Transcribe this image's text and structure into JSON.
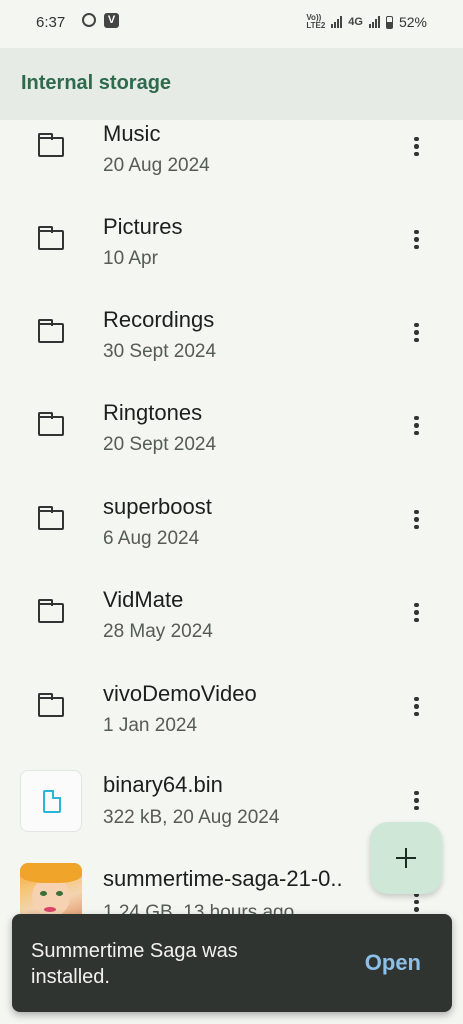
{
  "status_bar": {
    "time": "6:37",
    "notification_icon_2": "V",
    "volte_line1": "Vo))",
    "volte_line2": "LTE2",
    "network": "4G",
    "battery": "52%",
    "battery_level": 0.52
  },
  "app_bar": {
    "title": "Internal storage"
  },
  "files": [
    {
      "name": "Music",
      "meta": "20 Aug 2024",
      "kind": "folder"
    },
    {
      "name": "Pictures",
      "meta": "10 Apr",
      "kind": "folder"
    },
    {
      "name": "Recordings",
      "meta": "30 Sept 2024",
      "kind": "folder"
    },
    {
      "name": "Ringtones",
      "meta": "20 Sept 2024",
      "kind": "folder"
    },
    {
      "name": "superboost",
      "meta": "6 Aug 2024",
      "kind": "folder"
    },
    {
      "name": "VidMate",
      "meta": "28 May 2024",
      "kind": "folder"
    },
    {
      "name": "vivoDemoVideo",
      "meta": "1 Jan 2024",
      "kind": "folder"
    },
    {
      "name": "binary64.bin",
      "meta": "322 kB, 20 Aug 2024",
      "kind": "file"
    },
    {
      "name": "summertime-saga-21-0..",
      "meta": "1.24 GB, 13 hours ago",
      "kind": "apk"
    }
  ],
  "fab": {
    "icon": "add-icon"
  },
  "snackbar": {
    "message": "Summertime Saga was installed.",
    "action": "Open"
  },
  "colors": {
    "accent": "#2e6a4b",
    "background": "#f3f6f1",
    "fab": "#cfe7d6",
    "snackbar": "#303431",
    "snackbar_action": "#8cc0e8"
  }
}
